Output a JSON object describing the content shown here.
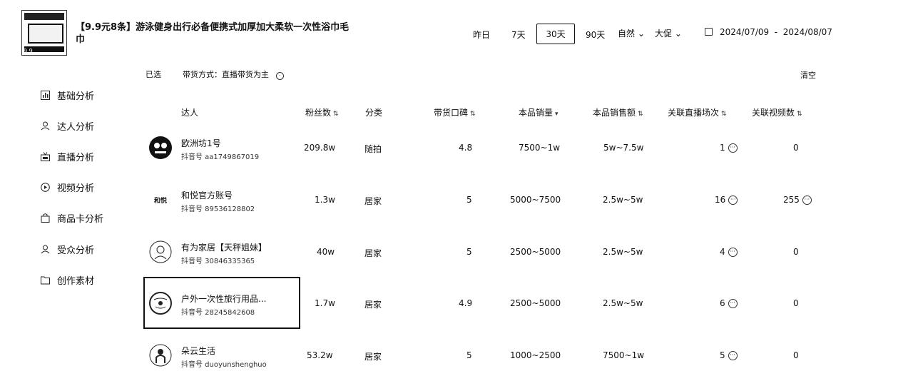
{
  "header": {
    "product_title": "【9.9元8条】游泳健身出行必备便携式加厚加大柔软一次性浴巾毛巾",
    "thumb_tag": "9.9",
    "ranges": [
      "昨日",
      "7天",
      "30天",
      "90天"
    ],
    "active_range": "30天",
    "dropdowns": [
      "自然",
      "大促"
    ],
    "date_range": "2024/07/09  -  2024/08/07"
  },
  "filter": {
    "selected_label": "已选",
    "chip": "带货方式：直播带货为主",
    "clear": "清空"
  },
  "sidebar": {
    "items": [
      {
        "label": "基础分析",
        "icon": "bar-chart-icon"
      },
      {
        "label": "达人分析",
        "icon": "person-icon"
      },
      {
        "label": "直播分析",
        "icon": "live-icon"
      },
      {
        "label": "视频分析",
        "icon": "play-icon"
      },
      {
        "label": "商品卡分析",
        "icon": "bag-icon"
      },
      {
        "label": "受众分析",
        "icon": "audience-icon"
      },
      {
        "label": "创作素材",
        "icon": "folder-icon"
      }
    ]
  },
  "table": {
    "columns": [
      "达人",
      "粉丝数",
      "分类",
      "带货口碑",
      "本品销量",
      "本品销售额",
      "关联直播场次",
      "关联视频数"
    ],
    "rows": [
      {
        "name": "欧洲坊1号",
        "account": "抖音号 aa1749867019",
        "fans": "209.8w",
        "category": "随拍",
        "rating": "4.8",
        "sales": "7500~1w",
        "revenue": "5w~7.5w",
        "live": "1",
        "video": "0"
      },
      {
        "name": "和悦官方账号",
        "account": "抖音号 89536128802",
        "fans": "1.3w",
        "category": "居家",
        "rating": "5",
        "sales": "5000~7500",
        "revenue": "2.5w~5w",
        "live": "16",
        "video": "255"
      },
      {
        "name": "有为家居【天秤姐妹】",
        "account": "抖音号 30846335365",
        "fans": "40w",
        "category": "居家",
        "rating": "5",
        "sales": "2500~5000",
        "revenue": "2.5w~5w",
        "live": "4",
        "video": "0"
      },
      {
        "name": "户外一次性旅行用品...",
        "account": "抖音号 28245842608",
        "fans": "1.7w",
        "category": "居家",
        "rating": "4.9",
        "sales": "2500~5000",
        "revenue": "2.5w~5w",
        "live": "6",
        "video": "0"
      },
      {
        "name": "朵云生活",
        "account": "抖音号 duoyunshenghuo",
        "fans": "53.2w",
        "category": "居家",
        "rating": "5",
        "sales": "1000~2500",
        "revenue": "7500~1w",
        "live": "5",
        "video": "0"
      }
    ],
    "avatar_text": {
      "row1": "和悦"
    }
  }
}
